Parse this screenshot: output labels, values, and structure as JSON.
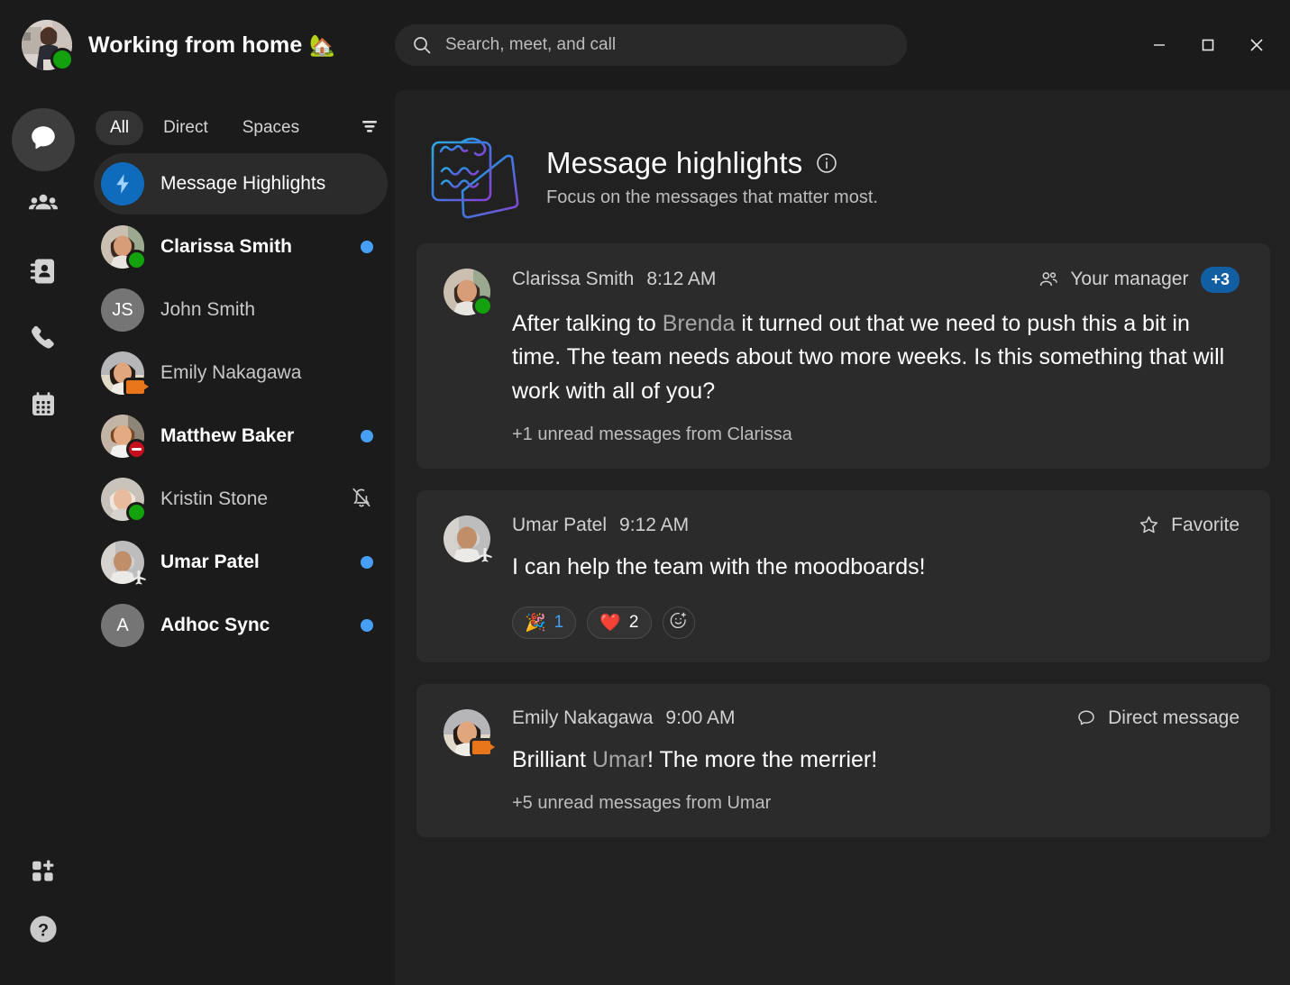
{
  "titlebar": {
    "status_text": "Working from home",
    "status_emoji": "🏡",
    "avatar_name": "user-avatar",
    "presence": "available",
    "search": {
      "placeholder": "Search, meet, and call",
      "value": ""
    },
    "window": {
      "minimize": "Minimize",
      "maximize": "Maximize",
      "close": "Close"
    }
  },
  "rail": {
    "items": [
      {
        "name": "chat",
        "label": "Chat",
        "active": true
      },
      {
        "name": "teams",
        "label": "Teams",
        "active": false
      },
      {
        "name": "contacts",
        "label": "Contacts",
        "active": false
      },
      {
        "name": "calls",
        "label": "Calls",
        "active": false
      },
      {
        "name": "calendar",
        "label": "Calendar",
        "active": false
      }
    ],
    "bottom": [
      {
        "name": "apps",
        "label": "Apps"
      },
      {
        "name": "help",
        "label": "Help"
      }
    ]
  },
  "chatlist": {
    "tabs": [
      {
        "label": "All",
        "active": true
      },
      {
        "label": "Direct",
        "active": false
      },
      {
        "label": "Spaces",
        "active": false
      }
    ],
    "filter_label": "Filter",
    "items": [
      {
        "name": "Message Highlights",
        "type": "highlights",
        "selected": true,
        "unread": false,
        "badge": "none",
        "right": "none"
      },
      {
        "name": "Clarissa Smith",
        "type": "photo",
        "selected": false,
        "unread": true,
        "badge": "available",
        "right": "unread-dot"
      },
      {
        "name": "John Smith",
        "type": "initials",
        "initials": "JS",
        "selected": false,
        "unread": false,
        "badge": "none",
        "right": "none"
      },
      {
        "name": "Emily Nakagawa",
        "type": "photo",
        "selected": false,
        "unread": false,
        "badge": "video",
        "right": "none"
      },
      {
        "name": "Matthew Baker",
        "type": "photo",
        "selected": false,
        "unread": true,
        "badge": "dnd",
        "right": "unread-dot"
      },
      {
        "name": "Kristin Stone",
        "type": "photo",
        "selected": false,
        "unread": false,
        "badge": "available",
        "right": "muted"
      },
      {
        "name": "Umar Patel",
        "type": "photo",
        "selected": false,
        "unread": true,
        "badge": "ooo",
        "right": "unread-dot"
      },
      {
        "name": "Adhoc Sync",
        "type": "initials",
        "initials": "A",
        "selected": false,
        "unread": true,
        "badge": "none",
        "right": "unread-dot"
      }
    ]
  },
  "main": {
    "title": "Message highlights",
    "subtitle": "Focus on the messages that matter most.",
    "info_label": "More information",
    "cards": [
      {
        "sender": "Clarissa Smith",
        "time": "8:12 AM",
        "badge": "available",
        "action": {
          "icon": "people-icon",
          "label": "Your manager",
          "count": "+3"
        },
        "text_parts": [
          {
            "t": "After talking to ",
            "mention": false
          },
          {
            "t": "Brenda",
            "mention": true
          },
          {
            "t": " it turned out that we need to push this a bit in time. The team needs about two more weeks. Is this something that will work with all of you?",
            "mention": false
          }
        ],
        "unread_note": "+1 unread messages from Clarissa",
        "reactions": []
      },
      {
        "sender": "Umar Patel",
        "time": "9:12 AM",
        "badge": "ooo",
        "action": {
          "icon": "star-icon",
          "label": "Favorite",
          "count": ""
        },
        "text_parts": [
          {
            "t": "I can help the team with the moodboards!",
            "mention": false
          }
        ],
        "unread_note": "",
        "reactions": [
          {
            "emoji": "🎉",
            "count": "1",
            "mine": true
          },
          {
            "emoji": "❤️",
            "count": "2",
            "mine": false
          }
        ],
        "add_reaction_label": "Add reaction"
      },
      {
        "sender": "Emily Nakagawa",
        "time": "9:00 AM",
        "badge": "video",
        "action": {
          "icon": "chat-bubble-icon",
          "label": "Direct message",
          "count": ""
        },
        "text_parts": [
          {
            "t": "Brilliant ",
            "mention": false
          },
          {
            "t": "Umar",
            "mention": true
          },
          {
            "t": "! The more the merrier!",
            "mention": false
          }
        ],
        "unread_note": "+5 unread messages from Umar",
        "reactions": []
      }
    ]
  },
  "colors": {
    "accent_blue": "#0f6cbd",
    "unread_dot": "#479ef5",
    "badge_pill": "#115ea3",
    "available_green": "#13a10e",
    "dnd_red": "#c50f1f",
    "video_orange": "#e8751a",
    "window_bg": "#1b1b1b",
    "panel_bg": "#212121",
    "card_bg": "#2b2b2b"
  }
}
